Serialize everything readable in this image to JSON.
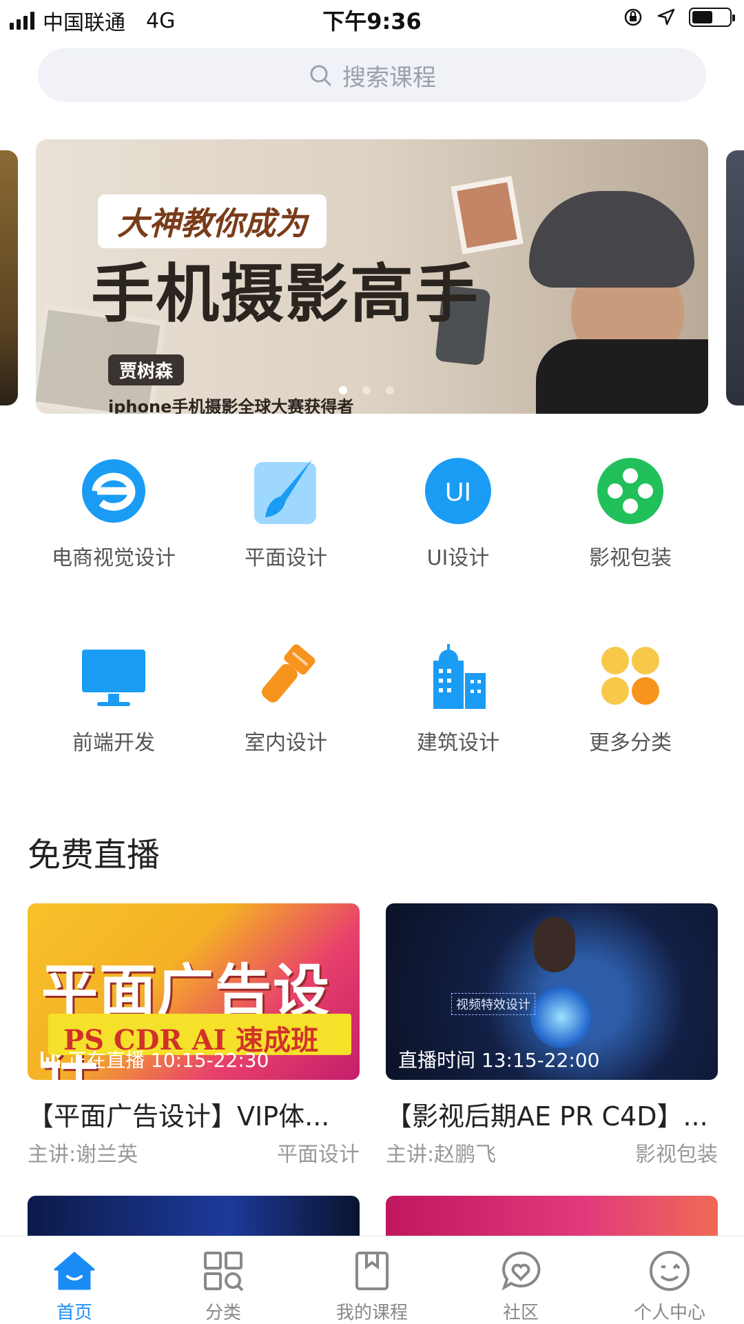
{
  "status_bar": {
    "carrier": "中国联通",
    "network": "4G",
    "time": "下午9:36",
    "battery_level": 0.55
  },
  "search": {
    "placeholder": "搜索课程"
  },
  "banner": {
    "subtitle": "大神教你成为",
    "title": "手机摄影高手",
    "name_tag": "贾树森",
    "caption": "iphone手机摄影全球大赛获得者",
    "active_slide": 1,
    "slide_count": 3
  },
  "categories": [
    {
      "label": "电商视觉设计",
      "icon": "ecommerce-e-icon",
      "color": "#1a9cf5"
    },
    {
      "label": "平面设计",
      "icon": "paintbrush-icon",
      "color": "#1a9cf5"
    },
    {
      "label": "UI设计",
      "icon": "ui-badge-icon",
      "color": "#1a9cf5"
    },
    {
      "label": "影视包装",
      "icon": "film-reel-icon",
      "color": "#22c05a"
    },
    {
      "label": "前端开发",
      "icon": "monitor-icon",
      "color": "#1a9cf5"
    },
    {
      "label": "室内设计",
      "icon": "flashlight-icon",
      "color": "#f7941d"
    },
    {
      "label": "建筑设计",
      "icon": "building-icon",
      "color": "#1a9cf5"
    },
    {
      "label": "更多分类",
      "icon": "more-dots-icon",
      "color": "#f7b733"
    }
  ],
  "live": {
    "section_title": "免费直播",
    "cards": [
      {
        "thumb_title": "平面广告设计",
        "thumb_band": "PS CDR AI 速成班",
        "status": "正在直播 10:15-22:30",
        "title": "【平面广告设计】VIP体...",
        "teacher": "主讲:谢兰英",
        "category": "平面设计"
      },
      {
        "thumb_label": "视频特效设计",
        "status": "直播时间 13:15-22:00",
        "title": "【影视后期AE PR C4D】...",
        "teacher": "主讲:赵鹏飞",
        "category": "影视包装"
      }
    ]
  },
  "tabbar": {
    "active": "首页",
    "accent": "#1a8cf5",
    "items": [
      {
        "label": "首页",
        "icon": "home-icon"
      },
      {
        "label": "分类",
        "icon": "category-grid-icon"
      },
      {
        "label": "我的课程",
        "icon": "bookmark-icon"
      },
      {
        "label": "社区",
        "icon": "chat-heart-icon"
      },
      {
        "label": "个人中心",
        "icon": "smiley-profile-icon"
      }
    ]
  }
}
